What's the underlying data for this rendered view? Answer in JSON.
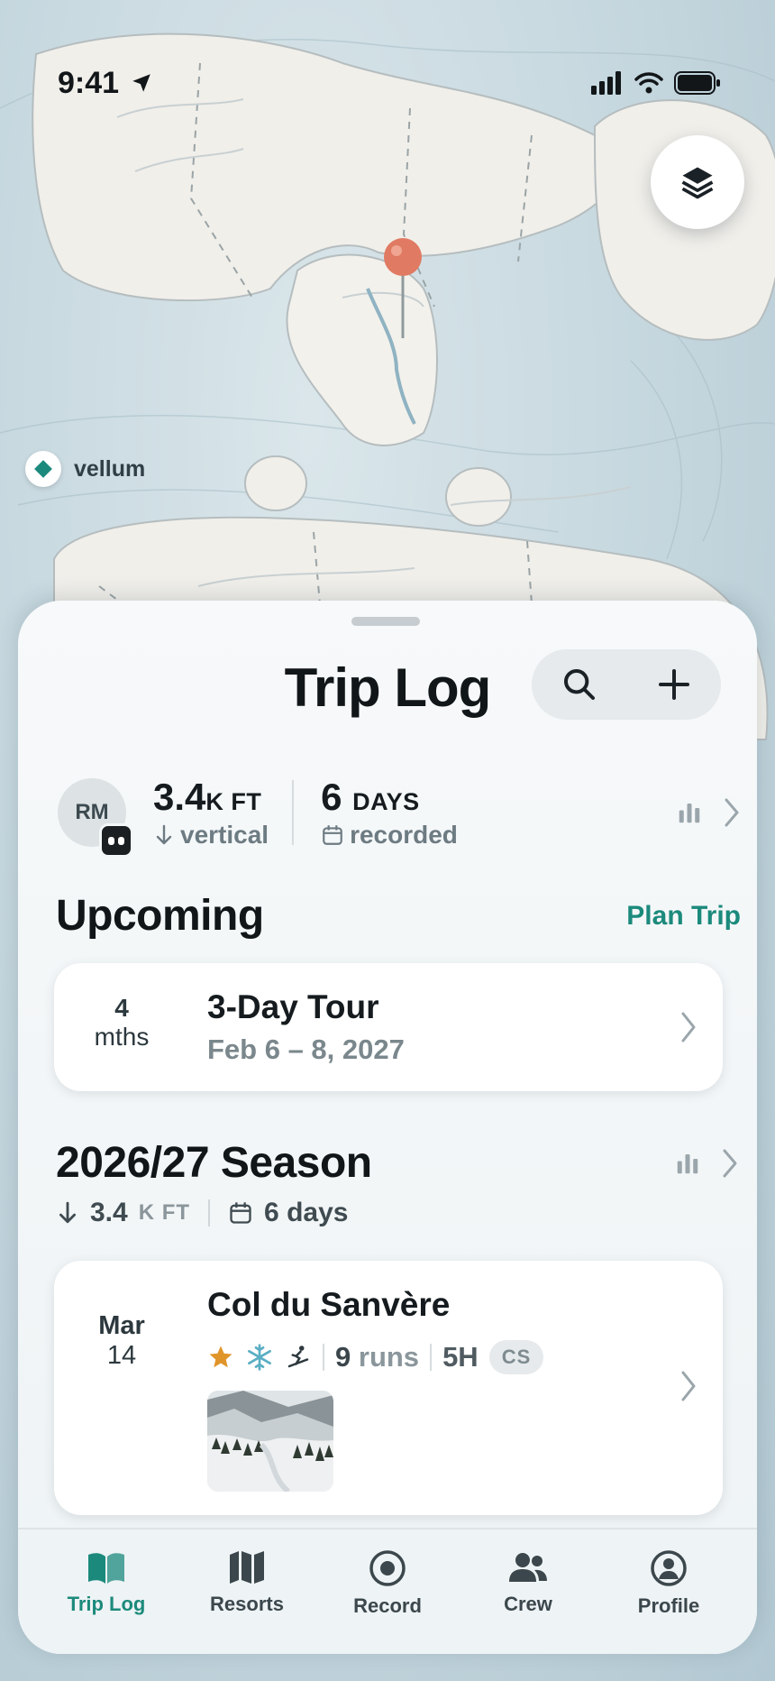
{
  "status_bar": {
    "time": "9:41"
  },
  "map": {
    "place_label": "vellum"
  },
  "sheet": {
    "title": "Trip Log",
    "summary": {
      "avatar_initials": "RM",
      "vertical_value": "3.4",
      "vertical_unit": "K FT",
      "vertical_label": "vertical",
      "days_value": "6",
      "days_unit": "DAYS",
      "days_label": "recorded"
    },
    "upcoming": {
      "heading": "Upcoming",
      "action": "Plan Trip",
      "trip": {
        "countdown_value": "4",
        "countdown_unit": "mths",
        "name": "3-Day Tour",
        "dates": "Feb 6 – 8, 2027"
      }
    },
    "season": {
      "heading": "2026/27 Season",
      "vertical_value": "3.4",
      "vertical_unit": "K FT",
      "days": "6 days",
      "entries": [
        {
          "month": "Mar",
          "day": "14",
          "resort": "Col du Sanvère",
          "runs_value": "9",
          "runs_label": "runs",
          "duration": "5H",
          "badge": "CS",
          "icons": [
            "star-icon",
            "snowflake-icon",
            "skier-icon"
          ]
        }
      ]
    }
  },
  "tabs": [
    {
      "label": "Trip Log",
      "icon": "book-icon",
      "active": true
    },
    {
      "label": "Resorts",
      "icon": "map-icon",
      "active": false
    },
    {
      "label": "Record",
      "icon": "record-icon",
      "active": false
    },
    {
      "label": "Crew",
      "icon": "people-icon",
      "active": false
    },
    {
      "label": "Profile",
      "icon": "profile-icon",
      "active": false
    }
  ],
  "colors": {
    "accent": "#1b8a7c",
    "pin": "#e07a62",
    "star": "#e0952a",
    "snow": "#5aaec4"
  }
}
